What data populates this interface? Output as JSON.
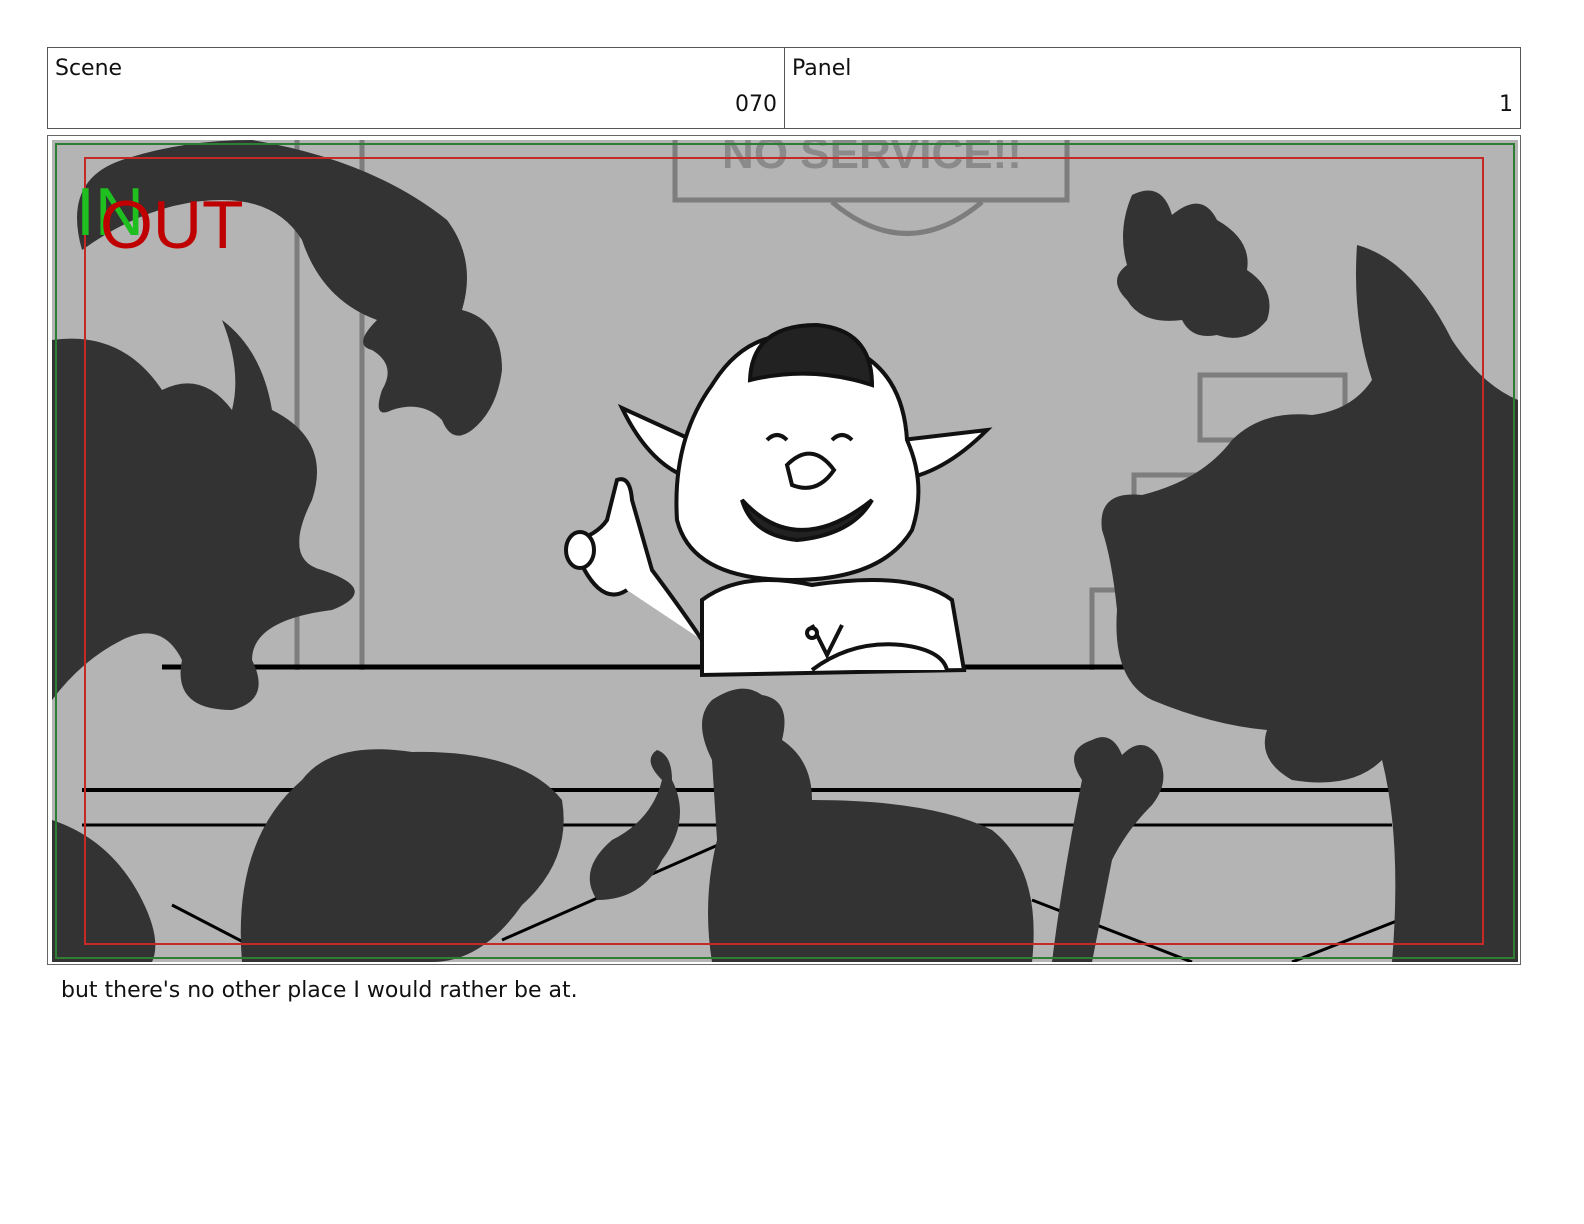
{
  "header": {
    "scene_label": "Scene",
    "scene_value": "070",
    "panel_label": "Panel",
    "panel_value": "1"
  },
  "panel_overlay": {
    "in_label": "IN",
    "out_label": "OUT",
    "sign_text": "NO SERVICE!!"
  },
  "caption": "but there's no other place I would rather be at.",
  "colors": {
    "background_gray": "#b4b4b4",
    "silhouette": "#333333",
    "in_green": "#1fbf1f",
    "out_red": "#c00000",
    "safe_frame_green": "#2e7d32",
    "title_safe_red": "#c62828"
  }
}
